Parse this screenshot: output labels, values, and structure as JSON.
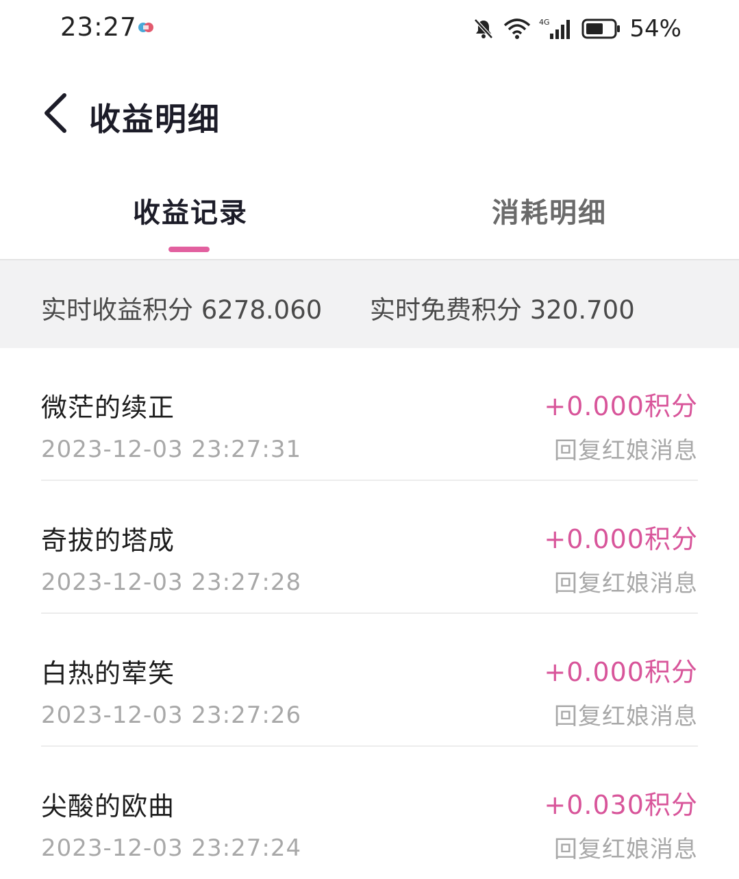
{
  "status_bar": {
    "time": "23:27",
    "battery_percent": "54%",
    "icons": [
      "app-notification-icon",
      "bell-muted-icon",
      "wifi-icon",
      "signal-4g-icon",
      "battery-icon"
    ]
  },
  "header": {
    "title": "收益明细",
    "back_icon": "chevron-left-icon"
  },
  "tabs": [
    {
      "label": "收益记录",
      "active": true
    },
    {
      "label": "消耗明细",
      "active": false
    }
  ],
  "summary": {
    "earned_label": "实时收益积分 6278.060",
    "free_label": "实时免费积分 320.700"
  },
  "records": [
    {
      "name": "微茫的续正",
      "time": "2023-12-03 23:27:31",
      "amount": "+0.000积分",
      "desc": "回复红娘消息"
    },
    {
      "name": "奇拔的塔成",
      "time": "2023-12-03 23:27:28",
      "amount": "+0.000积分",
      "desc": "回复红娘消息"
    },
    {
      "name": "白热的荤笑",
      "time": "2023-12-03 23:27:26",
      "amount": "+0.000积分",
      "desc": "回复红娘消息"
    },
    {
      "name": "尖酸的欧曲",
      "time": "2023-12-03 23:27:24",
      "amount": "+0.030积分",
      "desc": "回复红娘消息"
    }
  ],
  "colors": {
    "accent": "#e2609f",
    "amount": "#d8559a",
    "summary_bg": "#f2f2f3"
  }
}
